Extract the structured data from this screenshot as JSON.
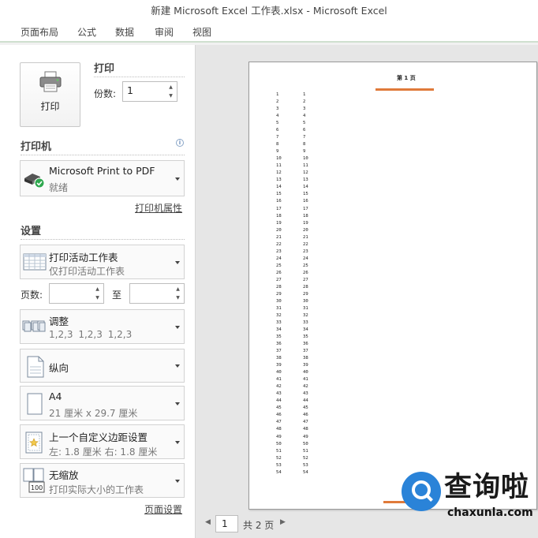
{
  "window": {
    "title": "新建 Microsoft Excel 工作表.xlsx  -  Microsoft Excel"
  },
  "ribbon": {
    "tabs": [
      "页面布局",
      "公式",
      "数据",
      "审阅",
      "视图"
    ]
  },
  "print": {
    "button_label": "打印",
    "section_title": "打印",
    "copies_label": "份数:",
    "copies_value": "1"
  },
  "printer": {
    "section_title": "打印机",
    "name": "Microsoft Print to PDF",
    "status": "就绪",
    "properties_link": "打印机属性"
  },
  "settings": {
    "section_title": "设置",
    "what_to_print": {
      "title": "打印活动工作表",
      "subtitle": "仅打印活动工作表"
    },
    "pages_label": "页数:",
    "pages_to_label": "至",
    "pages_from_value": "",
    "pages_to_value": "",
    "collate": {
      "title": "调整",
      "subtitle": "1,2,3    1,2,3    1,2,3"
    },
    "orientation": {
      "title": "纵向"
    },
    "paper": {
      "title": "A4",
      "subtitle": "21 厘米 x 29.7 厘米"
    },
    "margins": {
      "title": "上一个自定义边距设置",
      "subtitle": "左:  1.8 厘米    右:  1.8 厘米"
    },
    "scaling": {
      "title": "无缩放",
      "subtitle": "打印实际大小的工作表",
      "icon_text": "100"
    },
    "page_setup_link": "页面设置"
  },
  "preview": {
    "page_header": "第 1 页",
    "row_count": 54,
    "current_page": "1",
    "total_pages_text": "共 2 页"
  },
  "watermark": {
    "brand_text": "查询啦",
    "url": "chaxunla.com"
  }
}
